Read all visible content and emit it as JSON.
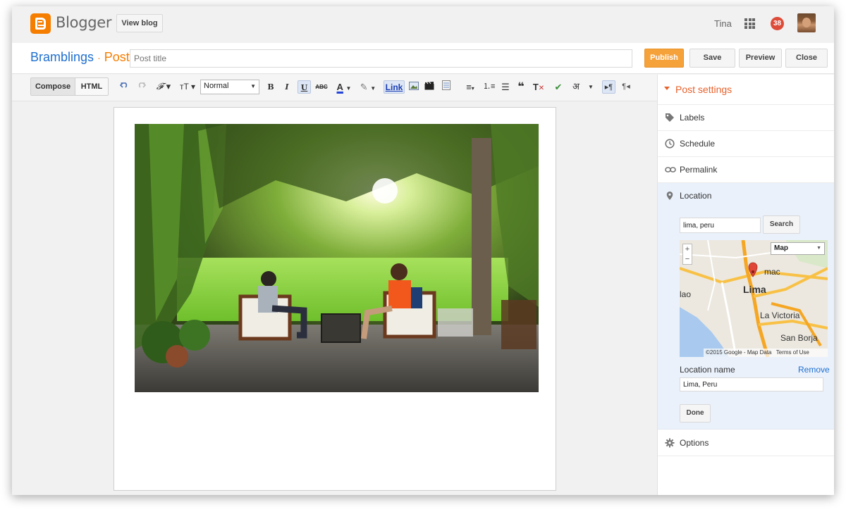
{
  "app": {
    "brand": "Blogger",
    "view_blog": "View blog",
    "user_name": "Tina",
    "notification_count": "38"
  },
  "post": {
    "blog_name": "Bramblings",
    "separator": "·",
    "section": "Post",
    "title_placeholder": "Post title",
    "publish": "Publish",
    "save": "Save",
    "preview": "Preview",
    "close": "Close"
  },
  "toolbar": {
    "compose": "Compose",
    "html": "HTML",
    "font_size": "Normal",
    "link": "Link"
  },
  "sidebar": {
    "post_settings": "Post settings",
    "labels": "Labels",
    "schedule": "Schedule",
    "permalink": "Permalink",
    "location": "Location",
    "options": "Options"
  },
  "location": {
    "search_value": "lima, peru",
    "search_button": "Search",
    "map_type": "Map",
    "map_labels": [
      "Lima",
      "La Victoria",
      "San Borja",
      "lao",
      "mac"
    ],
    "map_credit": "©2015 Google - Map Data",
    "map_terms": "Terms of Use",
    "name_label": "Location name",
    "remove": "Remove",
    "name_value": "Lima, Peru",
    "done": "Done"
  },
  "colors": {
    "accent_orange": "#f57d00",
    "publish": "#f5a23b",
    "link_blue": "#1f6fcf",
    "notification_red": "#dd4b39",
    "location_panel": "#eaf1fb"
  }
}
